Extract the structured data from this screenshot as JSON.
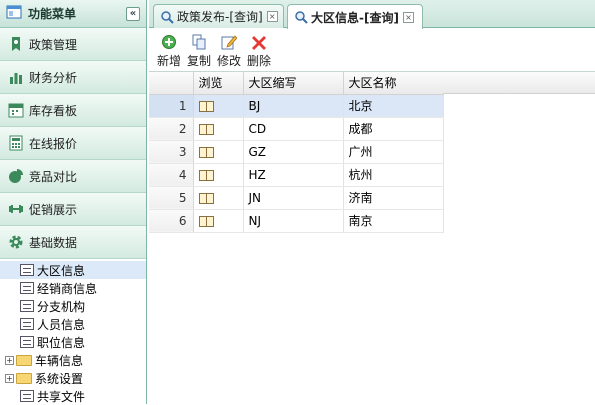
{
  "sidebar": {
    "title": "功能菜单",
    "collapse_glyph": "«",
    "items": [
      {
        "label": "政策管理",
        "icon": "bookmark-icon"
      },
      {
        "label": "财务分析",
        "icon": "bar-chart-icon"
      },
      {
        "label": "库存看板",
        "icon": "calendar-icon"
      },
      {
        "label": "在线报价",
        "icon": "calculator-icon"
      },
      {
        "label": "竞品对比",
        "icon": "pie-chart-icon"
      },
      {
        "label": "促销展示",
        "icon": "dumbbell-icon"
      },
      {
        "label": "基础数据",
        "icon": "gear-icon"
      }
    ],
    "tree": [
      {
        "label": "大区信息",
        "type": "leaf",
        "selected": true
      },
      {
        "label": "经销商信息",
        "type": "leaf"
      },
      {
        "label": "分支机构",
        "type": "leaf"
      },
      {
        "label": "人员信息",
        "type": "leaf"
      },
      {
        "label": "职位信息",
        "type": "leaf"
      },
      {
        "label": "车辆信息",
        "type": "folder",
        "expander": "+"
      },
      {
        "label": "系统设置",
        "type": "folder",
        "expander": "+"
      },
      {
        "label": "共享文件",
        "type": "leaf"
      }
    ]
  },
  "tabs": [
    {
      "label": "政策发布-[查询]",
      "active": false,
      "close": "×"
    },
    {
      "label": "大区信息-[查询]",
      "active": true,
      "close": "×"
    }
  ],
  "toolbar": {
    "add_label": "新增",
    "copy_label": "复制",
    "edit_label": "修改",
    "delete_label": "删除"
  },
  "grid": {
    "columns": [
      "浏览",
      "大区缩写",
      "大区名称"
    ],
    "rows": [
      {
        "num": "1",
        "abbr": "BJ",
        "name": "北京",
        "selected": true
      },
      {
        "num": "2",
        "abbr": "CD",
        "name": "成都"
      },
      {
        "num": "3",
        "abbr": "GZ",
        "name": "广州"
      },
      {
        "num": "4",
        "abbr": "HZ",
        "name": "杭州"
      },
      {
        "num": "5",
        "abbr": "JN",
        "name": "济南"
      },
      {
        "num": "6",
        "abbr": "NJ",
        "name": "南京"
      }
    ]
  },
  "colors": {
    "accent": "#7fb6a3",
    "selection": "#dbe7f6"
  }
}
